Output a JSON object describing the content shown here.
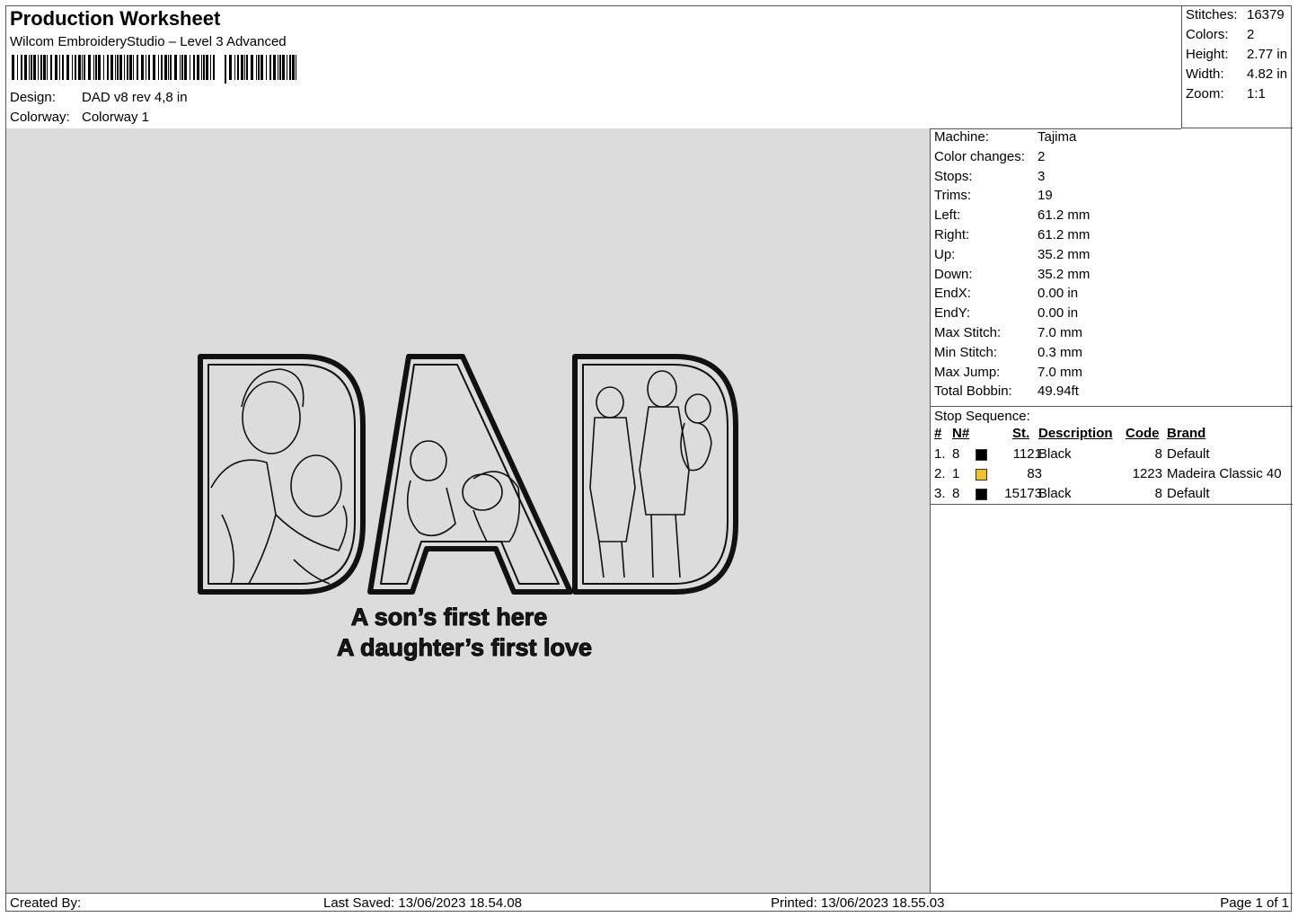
{
  "header": {
    "title": "Production Worksheet",
    "software": "Wilcom EmbroideryStudio – Level 3 Advanced",
    "design_label": "Design:",
    "design_value": "DAD v8 rev 4,8 in",
    "colorway_label": "Colorway:",
    "colorway_value": "Colorway 1"
  },
  "stats": [
    {
      "label": "Stitches:",
      "value": "16379"
    },
    {
      "label": "Colors:",
      "value": "2"
    },
    {
      "label": "Height:",
      "value": "2.77 in"
    },
    {
      "label": "Width:",
      "value": "4.82 in"
    },
    {
      "label": "Zoom:",
      "value": "1:1"
    }
  ],
  "machine_info": [
    {
      "label": "Machine:",
      "value": "Tajima"
    },
    {
      "label": "Color changes:",
      "value": "2"
    },
    {
      "label": "Stops:",
      "value": "3"
    },
    {
      "label": "Trims:",
      "value": "19"
    },
    {
      "label": "Left:",
      "value": "61.2 mm"
    },
    {
      "label": "Right:",
      "value": "61.2 mm"
    },
    {
      "label": "Up:",
      "value": "35.2 mm"
    },
    {
      "label": "Down:",
      "value": "35.2 mm"
    },
    {
      "label": "EndX:",
      "value": "0.00 in"
    },
    {
      "label": "EndY:",
      "value": "0.00 in"
    },
    {
      "label": "Max Stitch:",
      "value": "7.0 mm"
    },
    {
      "label": "Min Stitch:",
      "value": "0.3 mm"
    },
    {
      "label": "Max Jump:",
      "value": "7.0 mm"
    },
    {
      "label": "Total Bobbin:",
      "value": "49.94ft"
    }
  ],
  "stop_sequence": {
    "title": "Stop Sequence:",
    "columns": [
      "#",
      "N#",
      "St.",
      "Description",
      "Code",
      "Brand"
    ],
    "rows": [
      {
        "num": "1.",
        "needle": "8",
        "color": "#000000",
        "stitches": "1121",
        "description": "Black",
        "code": "8",
        "brand": "Default"
      },
      {
        "num": "2.",
        "needle": "1",
        "color": "#f0c030",
        "stitches": "83",
        "description": "",
        "code": "1223",
        "brand": "Madeira Classic 40"
      },
      {
        "num": "3.",
        "needle": "8",
        "color": "#000000",
        "stitches": "15173",
        "description": "Black",
        "code": "8",
        "brand": "Default"
      }
    ]
  },
  "design_preview": {
    "line1": "A son’s first here",
    "line2": "A daughter’s first love"
  },
  "footer": {
    "created_by": "Created By:",
    "last_saved": "Last Saved: 13/06/2023 18.54.08",
    "printed": "Printed: 13/06/2023 18.55.03",
    "page": "Page 1 of 1"
  }
}
